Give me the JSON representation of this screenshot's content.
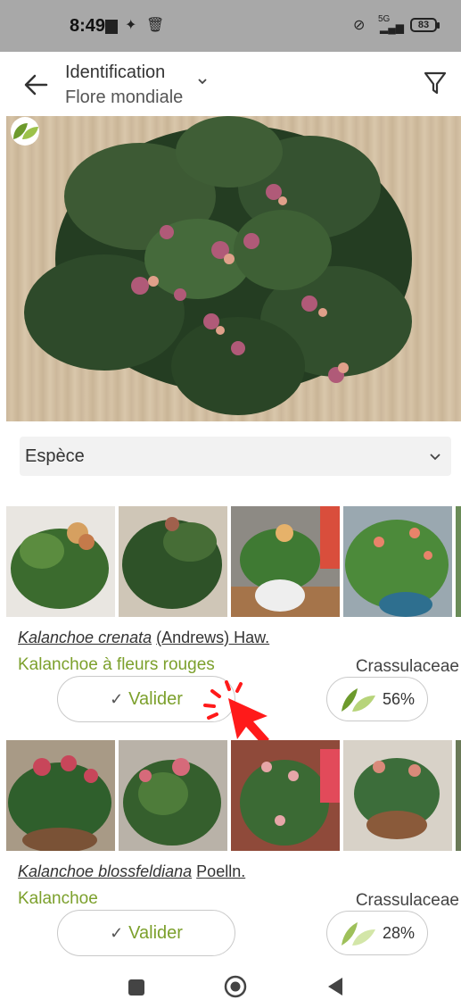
{
  "status_bar": {
    "time": "8:49",
    "network": "5G",
    "battery": "83"
  },
  "header": {
    "title": "Identification",
    "subtitle": "Flore mondiale"
  },
  "rank_selector": {
    "selected": "Espèce"
  },
  "results": [
    {
      "scientific_name": "Kalanchoe crenata",
      "author": "(Andrews) Haw.",
      "common_name": "Kalanchoe à fleurs rouges",
      "family": "Crassulaceae",
      "validate_label": "Valider",
      "score": "56%"
    },
    {
      "scientific_name": "Kalanchoe blossfeldiana",
      "author": "Poelln.",
      "common_name": "Kalanchoe",
      "family": "Crassulaceae",
      "validate_label": "Valider",
      "score": "28%"
    }
  ],
  "colors": {
    "accent_green": "#7ca02c",
    "tap_red": "#ff1a1a",
    "status_bar_bg": "#a8a8a8"
  },
  "icons": {
    "back": "arrow-left-icon",
    "dropdown": "chevron-down-icon",
    "filter": "filter-icon",
    "check": "check-icon",
    "leaf": "leaf-icon"
  }
}
